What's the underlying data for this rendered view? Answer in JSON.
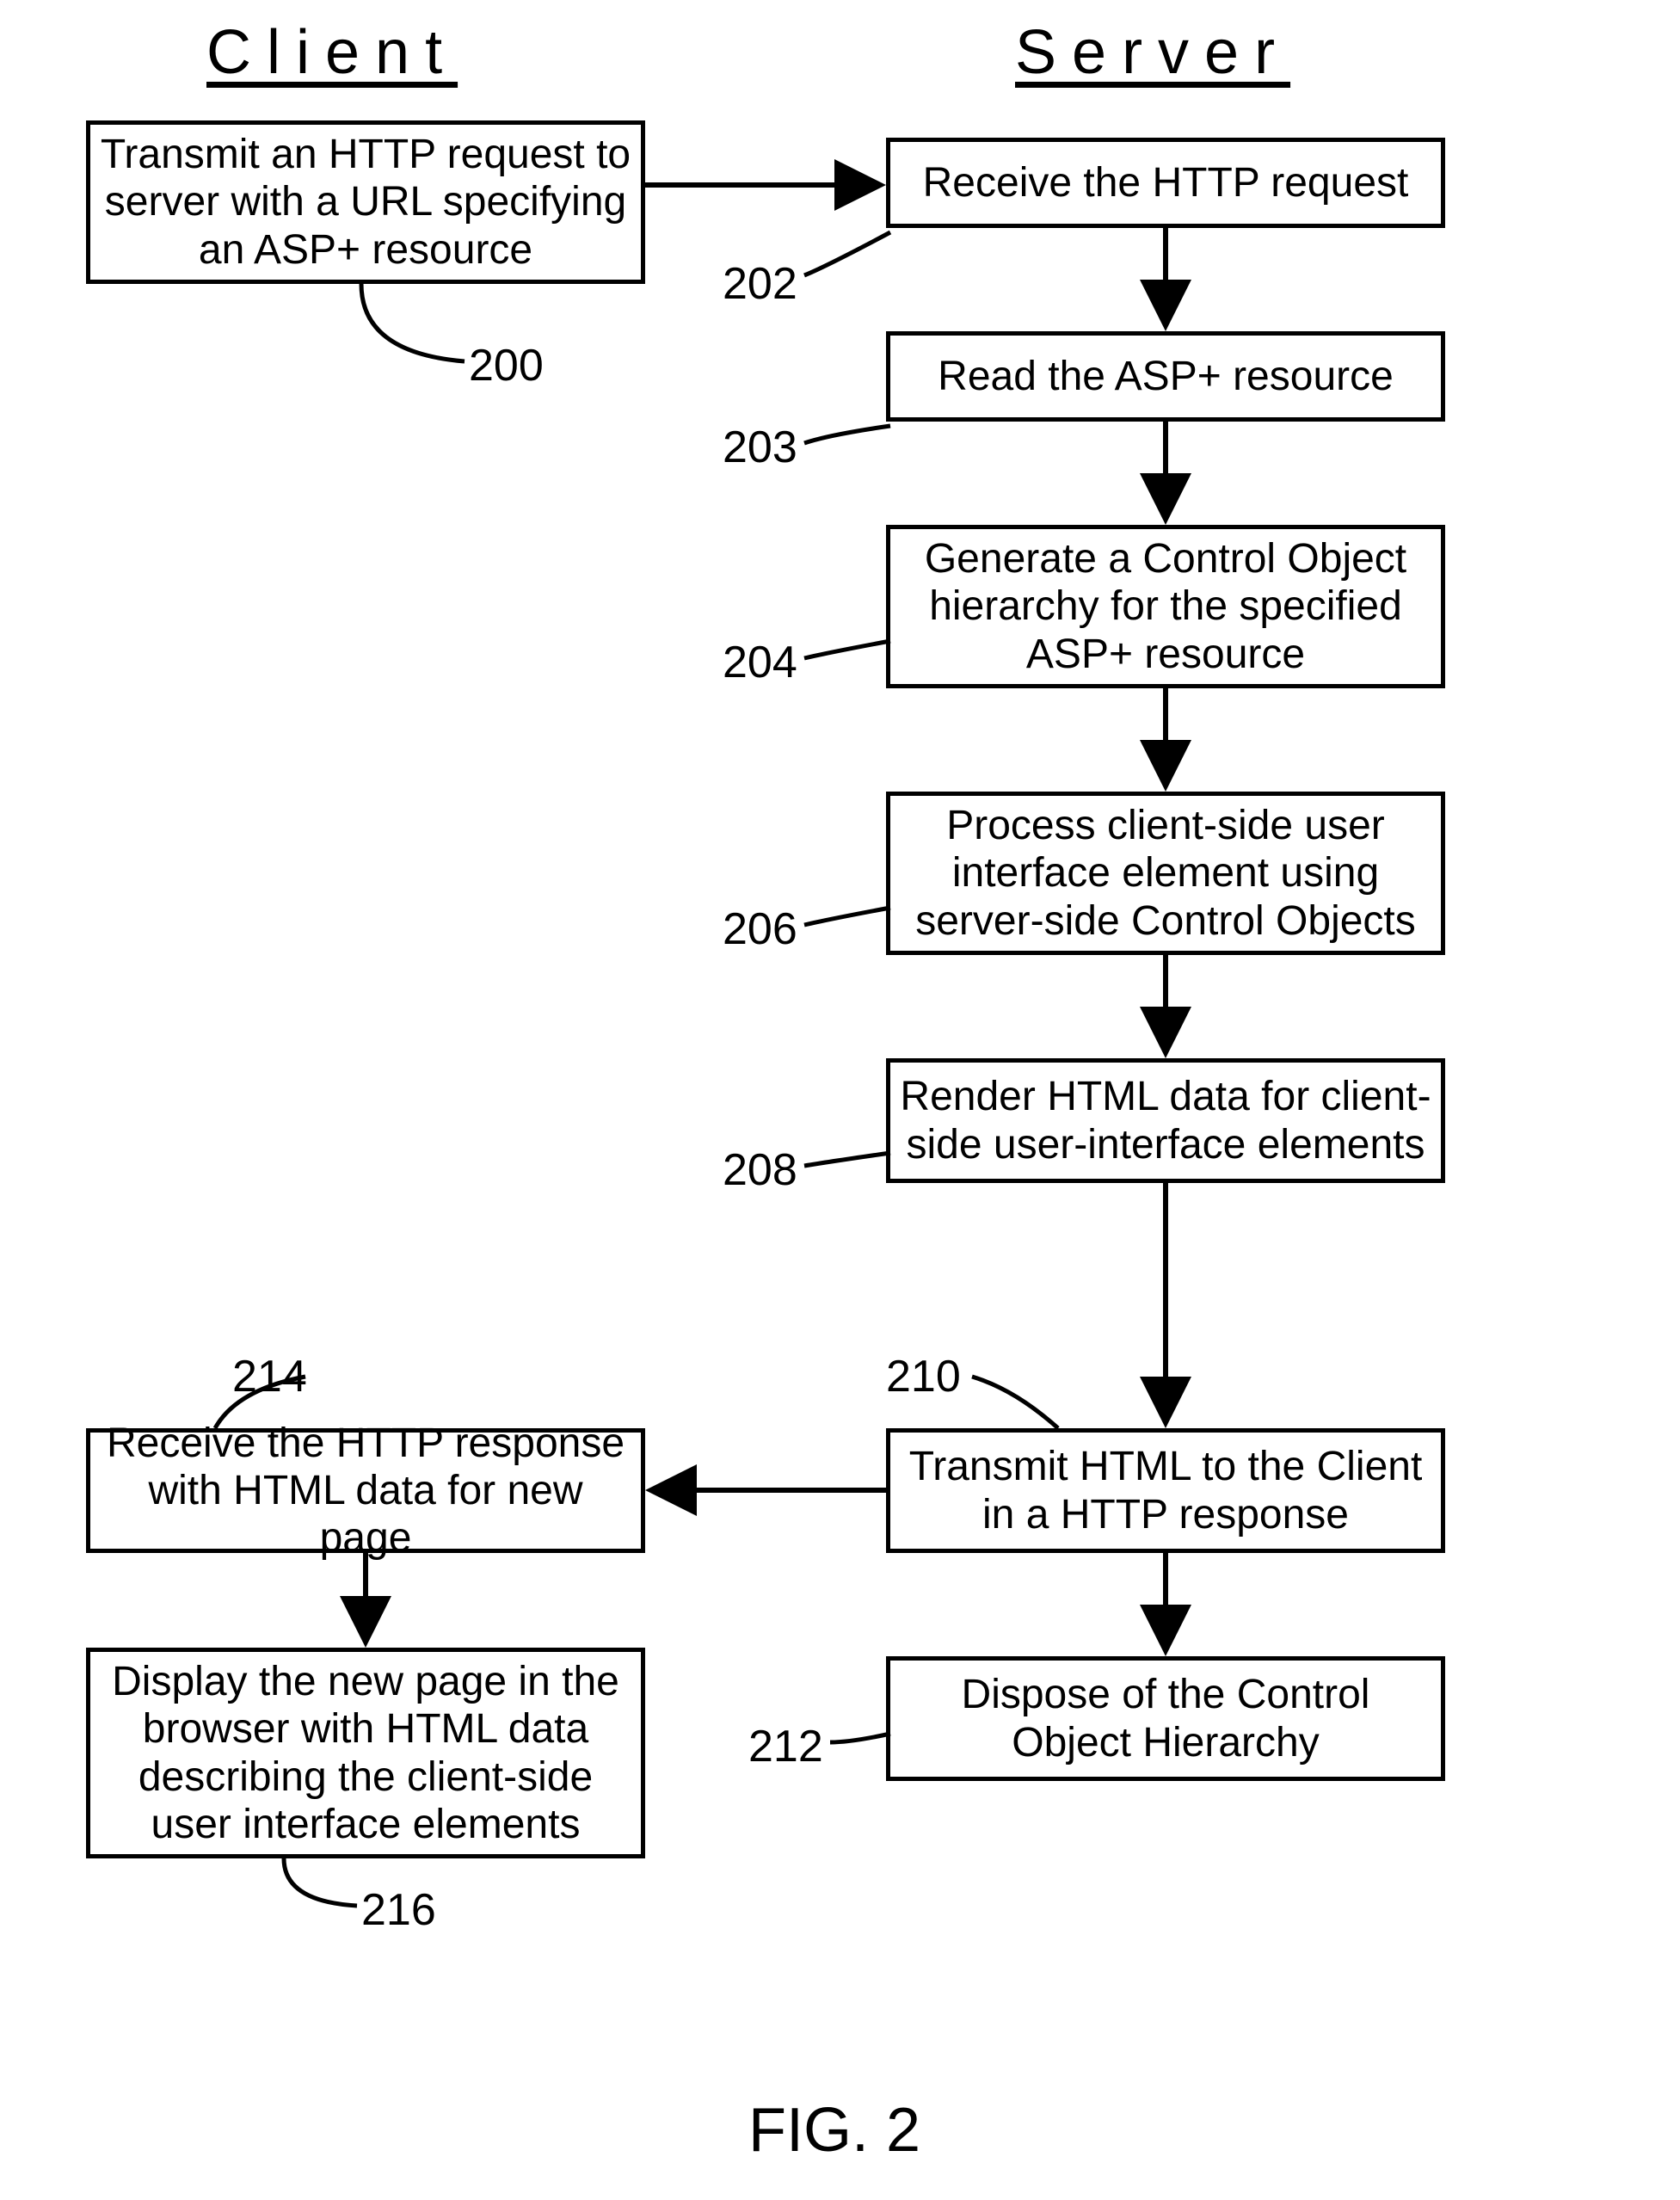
{
  "chart_data": {
    "type": "flowchart",
    "title": "FIG. 2",
    "columns": {
      "client": "Client",
      "server": "Server"
    },
    "nodes": [
      {
        "id": "200",
        "column": "client",
        "label": "Transmit an HTTP request to server with a URL specifying an ASP+ resource"
      },
      {
        "id": "202",
        "column": "server",
        "label": "Receive the HTTP request"
      },
      {
        "id": "203",
        "column": "server",
        "label": "Read the ASP+ resource"
      },
      {
        "id": "204",
        "column": "server",
        "label": "Generate a Control Object hierarchy for the specified ASP+ resource"
      },
      {
        "id": "206",
        "column": "server",
        "label": "Process client-side user interface element using server-side Control Objects"
      },
      {
        "id": "208",
        "column": "server",
        "label": "Render HTML data for client-side user-interface elements"
      },
      {
        "id": "210",
        "column": "server",
        "label": "Transmit HTML to the Client in a HTTP response"
      },
      {
        "id": "212",
        "column": "server",
        "label": "Dispose of the Control Object Hierarchy"
      },
      {
        "id": "214",
        "column": "client",
        "label": "Receive the HTTP response with HTML data for new page"
      },
      {
        "id": "216",
        "column": "client",
        "label": "Display the new page in the browser with HTML data describing the client-side user interface elements"
      }
    ],
    "edges": [
      {
        "from": "200",
        "to": "202"
      },
      {
        "from": "202",
        "to": "203"
      },
      {
        "from": "203",
        "to": "204"
      },
      {
        "from": "204",
        "to": "206"
      },
      {
        "from": "206",
        "to": "208"
      },
      {
        "from": "208",
        "to": "210"
      },
      {
        "from": "210",
        "to": "214"
      },
      {
        "from": "210",
        "to": "212"
      },
      {
        "from": "214",
        "to": "216"
      }
    ]
  },
  "headers": {
    "client": "Client",
    "server": "Server"
  },
  "boxes": {
    "b200": "Transmit an HTTP request to server with a URL specifying an ASP+ resource",
    "b202": "Receive the HTTP request",
    "b203": "Read the ASP+ resource",
    "b204": "Generate a Control Object hierarchy for the specified ASP+ resource",
    "b206": "Process client-side user interface element using server-side Control Objects",
    "b208": "Render HTML data for client-side user-interface elements",
    "b210": "Transmit HTML to the Client in a HTTP response",
    "b212": "Dispose of the Control Object Hierarchy",
    "b214": "Receive the HTTP response with HTML data for new page",
    "b216": "Display the new page in the browser with HTML data describing the client-side user interface elements"
  },
  "refs": {
    "r200": "200",
    "r202": "202",
    "r203": "203",
    "r204": "204",
    "r206": "206",
    "r208": "208",
    "r210": "210",
    "r212": "212",
    "r214": "214",
    "r216": "216"
  },
  "figure_label": "FIG. 2"
}
